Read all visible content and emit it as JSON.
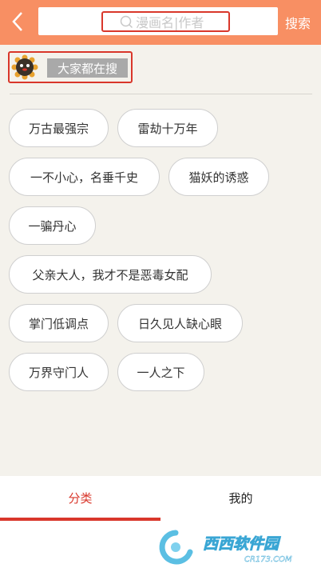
{
  "header": {
    "back": "back-arrow-icon",
    "search_placeholder": "漫画名|作者",
    "search_button": "搜索",
    "color": "#f88f63"
  },
  "hot": {
    "title": "大家都在搜",
    "tags": [
      "万古最强宗",
      "雷劫十万年",
      "一不小心，名垂千史",
      "猫妖的诱惑",
      "一骗丹心",
      "父亲大人，我才不是恶毒女配",
      "掌门低调点",
      "日久见人缺心眼",
      "万界守门人",
      "一人之下"
    ]
  },
  "bottom_nav": {
    "tabs": [
      {
        "label": "分类",
        "active": true
      },
      {
        "label": "我的",
        "active": false
      }
    ],
    "accent": "#d9372b"
  },
  "watermark": {
    "brand": "西西软件园",
    "url": "CR173.COM"
  }
}
